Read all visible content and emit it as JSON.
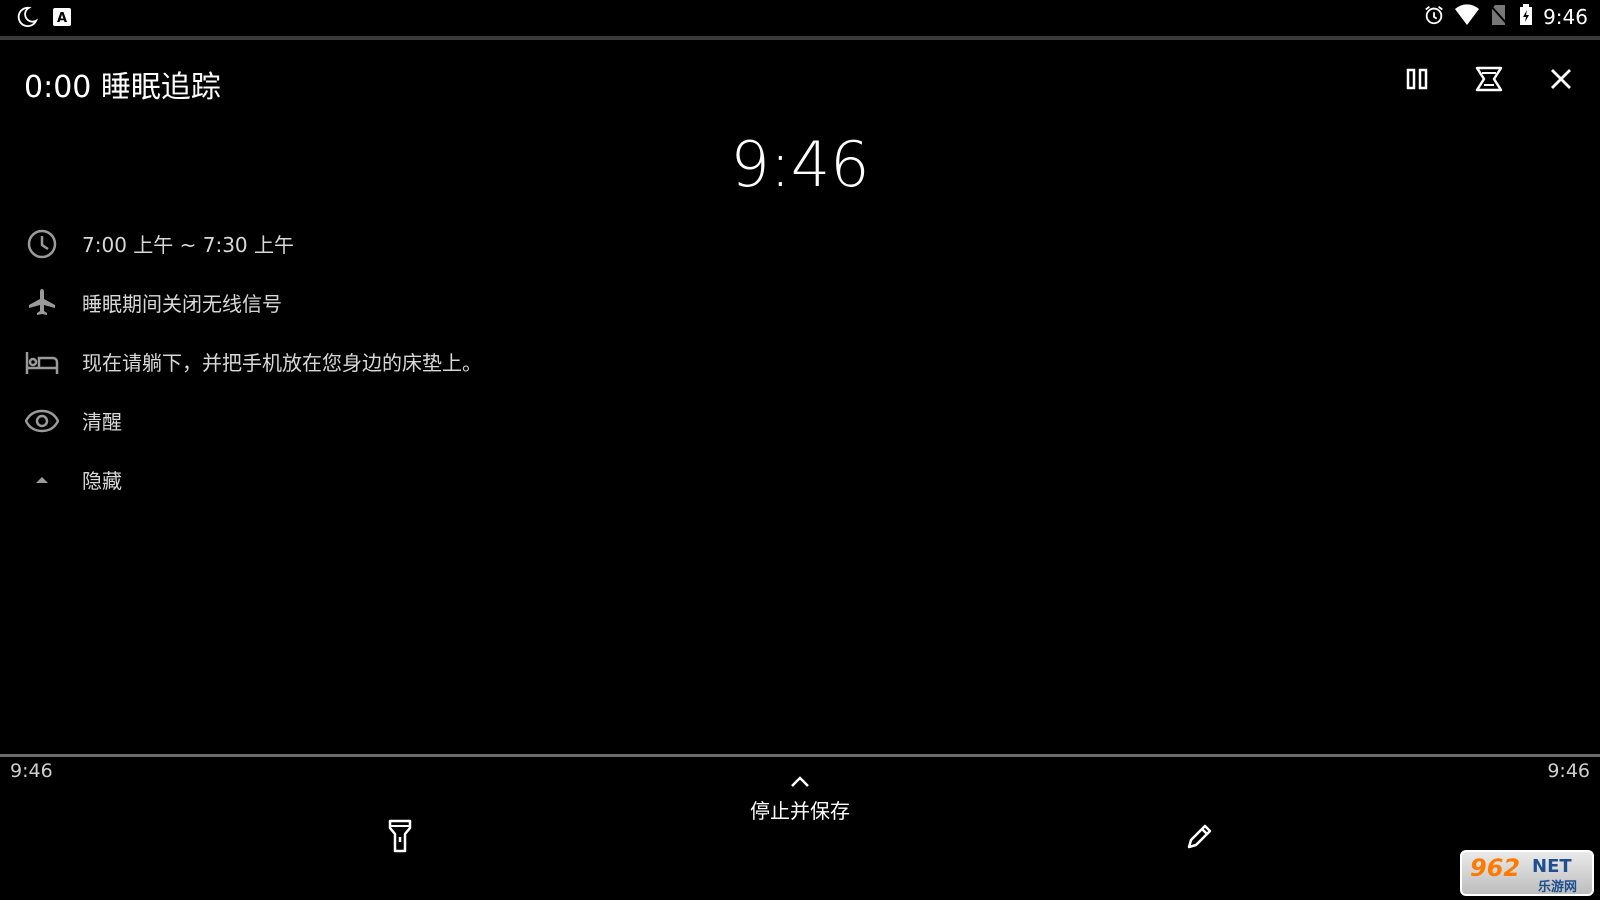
{
  "status_bar": {
    "time": "9:46",
    "left_icons": [
      "moon-icon",
      "a-keyboard-icon"
    ],
    "right_icons": [
      "alarm-icon",
      "wifi-icon",
      "no-sim-icon",
      "battery-charging-icon"
    ]
  },
  "header": {
    "title": "0:00 睡眠追踪",
    "actions": [
      "pause-icon",
      "lullaby-icon",
      "close-icon"
    ]
  },
  "main": {
    "current_time": "9:46",
    "info_rows": [
      {
        "icon": "clock-icon",
        "text": "7:00 上午 ~ 7:30 上午"
      },
      {
        "icon": "airplane-icon",
        "text": "睡眠期间关闭无线信号"
      },
      {
        "icon": "bed-icon",
        "text": "现在请躺下，并把手机放在您身边的床垫上。"
      },
      {
        "icon": "eye-icon",
        "text": "清醒"
      },
      {
        "icon": "chevron-up-icon",
        "text": "隐藏"
      }
    ]
  },
  "timeline": {
    "start": "9:46",
    "end": "9:46"
  },
  "bottom_bar": {
    "stop_save_label": "停止并保存",
    "left_icon": "flashlight-icon",
    "right_icon": "pencil-icon"
  },
  "watermark": {
    "digits": "962",
    "net": "NET",
    "cn": "乐游网"
  }
}
